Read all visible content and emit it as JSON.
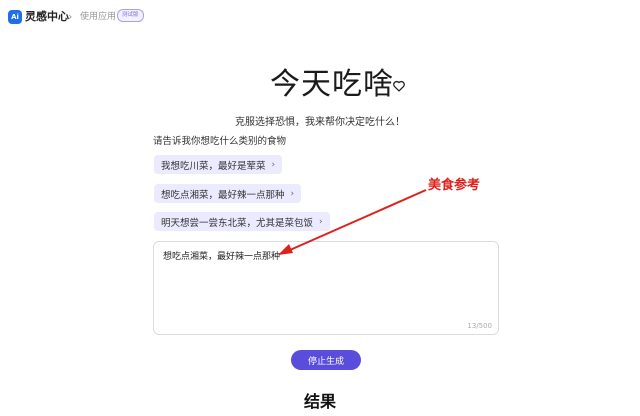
{
  "header": {
    "logo_text": "Ai",
    "app_name": "灵感中心",
    "breadcrumb_separator": "›",
    "breadcrumb": "使用应用",
    "badge": "测试版"
  },
  "main": {
    "title": "今天吃啥",
    "subtitle": "克服选择恐惧，我来帮你决定吃什么！",
    "prompt_label": "请告诉我你想吃什么类别的食物",
    "suggestions": [
      {
        "label": "我想吃川菜，最好是荤菜"
      },
      {
        "label": "想吃点湘菜，最好辣一点那种"
      },
      {
        "label": "明天想尝一尝东北菜，尤其是菜包饭"
      }
    ],
    "suggestion_chevron": "›",
    "input": {
      "value": "想吃点湘菜，最好辣一点那种",
      "counter": "13/500"
    },
    "stop_button": "停止生成",
    "result_title": "结果"
  },
  "annotation": {
    "text": "美食参考",
    "color": "#e0201b"
  },
  "colors": {
    "accent": "#5b4ddc",
    "chip_bg": "#eceaff",
    "logo": "#1f6fe5"
  }
}
